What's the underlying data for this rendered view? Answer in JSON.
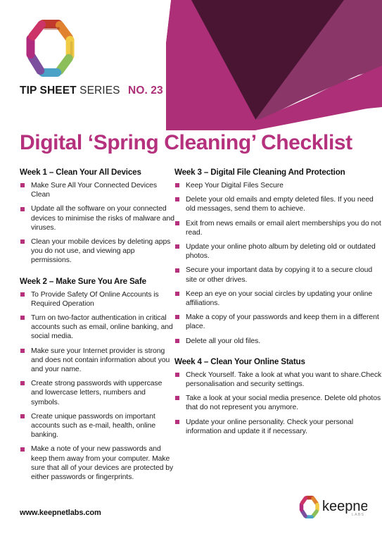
{
  "header": {
    "series_prefix": "TIP SHEET",
    "series_word": "SERIES",
    "series_number": "NO. 23",
    "logo_icon": "keepnet-hexagon-ring-logo",
    "art_icon": "magenta-chevron-banner"
  },
  "title": "Digital ‘Spring Cleaning’ Checklist",
  "colors": {
    "magenta": "#ad2f78",
    "mid_purple": "#8a3669",
    "dark_purple": "#4a1433",
    "title": "#b5317d",
    "bullet": "#b5317d",
    "text": "#1d1d1d"
  },
  "columns": {
    "left": [
      {
        "heading": "Week 1 – Clean Your All Devices",
        "items": [
          "Make Sure All Your Connected Devices Clean",
          "Update all the software on your connected devices to minimise the risks of malware and viruses.",
          "Clean your mobile devices by deleting apps you do not use, and viewing app permissions."
        ]
      },
      {
        "heading": "Week 2 – Make Sure You Are Safe",
        "items": [
          "To Provide Safety Of Online Accounts is Required Operation",
          "Turn on two-factor authentication in critical accounts such as email, online banking, and social media.",
          "Make sure your Internet provider is strong and does not contain information about you and your name.",
          "Create strong passwords with uppercase and lowercase letters, numbers and symbols.",
          "Create unique passwords on important accounts such as e-mail, health, online banking.",
          "Make a note of your new passwords and keep them away from your computer. Make sure that all of your devices are protected by either passwords or fingerprints."
        ]
      }
    ],
    "right": [
      {
        "heading": "Week 3 – Digital File Cleaning And Protection",
        "items": [
          "Keep Your Digital Files Secure",
          "Delete your old emails and empty deleted files. If you need old messages, send them to achieve.",
          "Exit from news emails or email alert memberships you do not read.",
          "Update your online photo album by deleting old or outdated photos.",
          "Secure your important data by copying it to a secure cloud site or other drives.",
          "Keep an eye on your social circles by updating your online affiliations.",
          "Make a copy of your passwords and keep them in a different place.",
          "Delete all your old files."
        ]
      },
      {
        "heading": "Week 4 – Clean Your Online Status",
        "items": [
          "Check Yourself. Take a look at what you want to share.Check personalisation and security settings.",
          "Take a look at your social media presence. Delete old photos that do not represent you anymore.",
          "Update your online personality. Check your personal information and update it if necessary."
        ]
      }
    ]
  },
  "footer": {
    "url": "www.keepnetlabs.com",
    "logo_wordmark": "keepnet",
    "logo_sub": "LABS",
    "logo_icon": "keepnet-hexagon-ring-logo"
  }
}
